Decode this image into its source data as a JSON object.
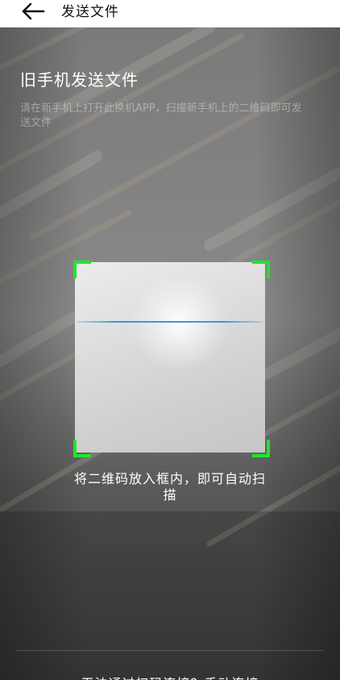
{
  "header": {
    "title": "发送文件",
    "back_icon": "arrow-left-icon"
  },
  "scanner": {
    "heading": "旧手机发送文件",
    "instructions": "请在新手机上打开此换机APP，扫描新手机上的二维码即可发送文件",
    "hint": "将二维码放入框内，即可自动扫描",
    "bottom_link": "无法通过扫码连接？手动连接",
    "accent_color": "#1ee62a",
    "scan_line_color": "#3a9bd8"
  }
}
